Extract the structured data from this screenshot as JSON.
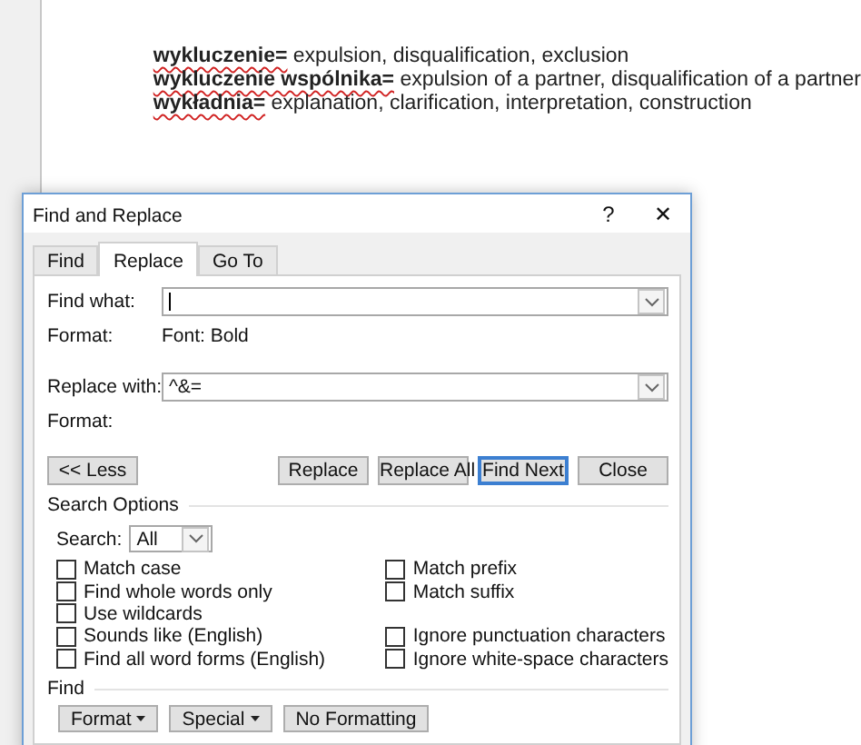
{
  "document": {
    "lines": [
      "**wykluczenie=** expulsion, disqualification, exclusion",
      "**wykluczenie wspólnika=** expulsion of a partner, disqualification of a partner",
      "**wykładnia=** explanation, clarification, interpretation, construction"
    ]
  },
  "dialog": {
    "title": "Find and Replace",
    "help": "?",
    "close": "✕",
    "tabs": [
      {
        "label": "Find",
        "selected": false
      },
      {
        "label": "Replace",
        "selected": true
      },
      {
        "label": "Go To",
        "selected": false
      }
    ],
    "find_what": {
      "label": "Find what:",
      "format_label": "Format:",
      "format_value": "Font: Bold"
    },
    "replace_with": {
      "label": "Replace with:",
      "value": "^&=",
      "format_label": "Format:"
    },
    "buttons": [
      {
        "label": "<< Less",
        "default": false
      },
      {
        "label": "Replace",
        "default": false
      },
      {
        "label": "Replace All",
        "default": false
      },
      {
        "label": "Find Next",
        "default": true
      },
      {
        "label": "Close",
        "default": false
      }
    ],
    "search_options": {
      "heading": "Search Options",
      "search_label": "Search:",
      "search_value": "All",
      "rows": [
        {
          "left": {
            "label": "Match case",
            "checked": false
          },
          "right": {
            "label": "Match prefix",
            "checked": false
          }
        },
        {
          "left": {
            "label": "Find whole words only",
            "checked": false
          },
          "right": {
            "label": "Match suffix",
            "checked": false
          }
        },
        {
          "left": {
            "label": "Use wildcards",
            "checked": false
          }
        },
        {
          "left": {
            "label": "Sounds like (English)",
            "checked": false
          },
          "right": {
            "label": "Ignore punctuation characters",
            "checked": false
          }
        },
        {
          "left": {
            "label": "Find all word forms (English)",
            "checked": false
          },
          "right": {
            "label": "Ignore white-space characters",
            "checked": false
          }
        }
      ]
    },
    "find_section": {
      "heading": "Find",
      "buttons": [
        {
          "label": "Format",
          "menu": true
        },
        {
          "label": "Special",
          "menu": true
        },
        {
          "label": "No Formatting",
          "menu": false
        }
      ]
    }
  }
}
